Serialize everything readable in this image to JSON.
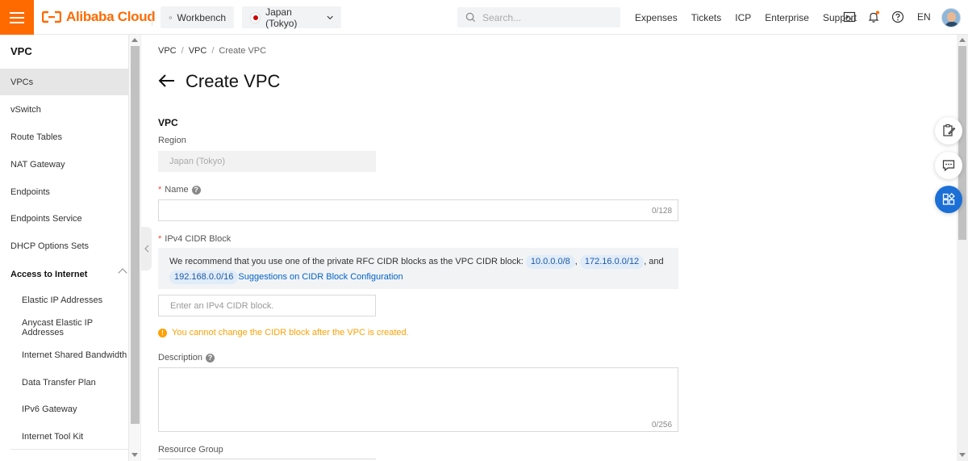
{
  "brand": {
    "name": "Alibaba Cloud",
    "accent": "#ff6a00"
  },
  "topbar": {
    "workbench": "Workbench",
    "region": "Japan (Tokyo)",
    "search_placeholder": "Search...",
    "links": [
      "Expenses",
      "Tickets",
      "ICP",
      "Enterprise",
      "Support"
    ],
    "language": "EN"
  },
  "sidebar": {
    "title": "VPC",
    "items": [
      {
        "label": "VPCs",
        "active": true
      },
      {
        "label": "vSwitch"
      },
      {
        "label": "Route Tables"
      },
      {
        "label": "NAT Gateway"
      },
      {
        "label": "Endpoints"
      },
      {
        "label": "Endpoints Service"
      },
      {
        "label": "DHCP Options Sets"
      }
    ],
    "group": {
      "label": "Access to Internet",
      "items": [
        "Elastic IP Addresses",
        "Anycast Elastic IP Addresses",
        "Internet Shared Bandwidth",
        "Data Transfer Plan",
        "IPv6 Gateway",
        "Internet Tool Kit"
      ]
    }
  },
  "breadcrumb": {
    "items": [
      "VPC",
      "VPC",
      "Create VPC"
    ],
    "separator": "/"
  },
  "page": {
    "title": "Create VPC",
    "section": "VPC",
    "region_label": "Region",
    "region_value": "Japan (Tokyo)",
    "name_label": "Name",
    "name_counter": "0/128",
    "cidr_label": "IPv4 CIDR Block",
    "cidr_tip_prefix": "We recommend that you use one of the private RFC CIDR blocks as the VPC CIDR block:",
    "cidr_blocks": [
      "10.0.0.0/8",
      "172.16.0.0/12",
      "192.168.0.0/16"
    ],
    "cidr_sep_comma": ",",
    "cidr_sep_and": ", and",
    "cidr_link": "Suggestions on CIDR Block Configuration",
    "cidr_placeholder": "Enter an IPv4 CIDR block.",
    "warning": "You cannot change the CIDR block after the VPC is created.",
    "description_label": "Description",
    "description_counter": "0/256",
    "resource_group_label": "Resource Group",
    "required_mark": "*",
    "help_glyph": "?",
    "warning_glyph": "!"
  }
}
